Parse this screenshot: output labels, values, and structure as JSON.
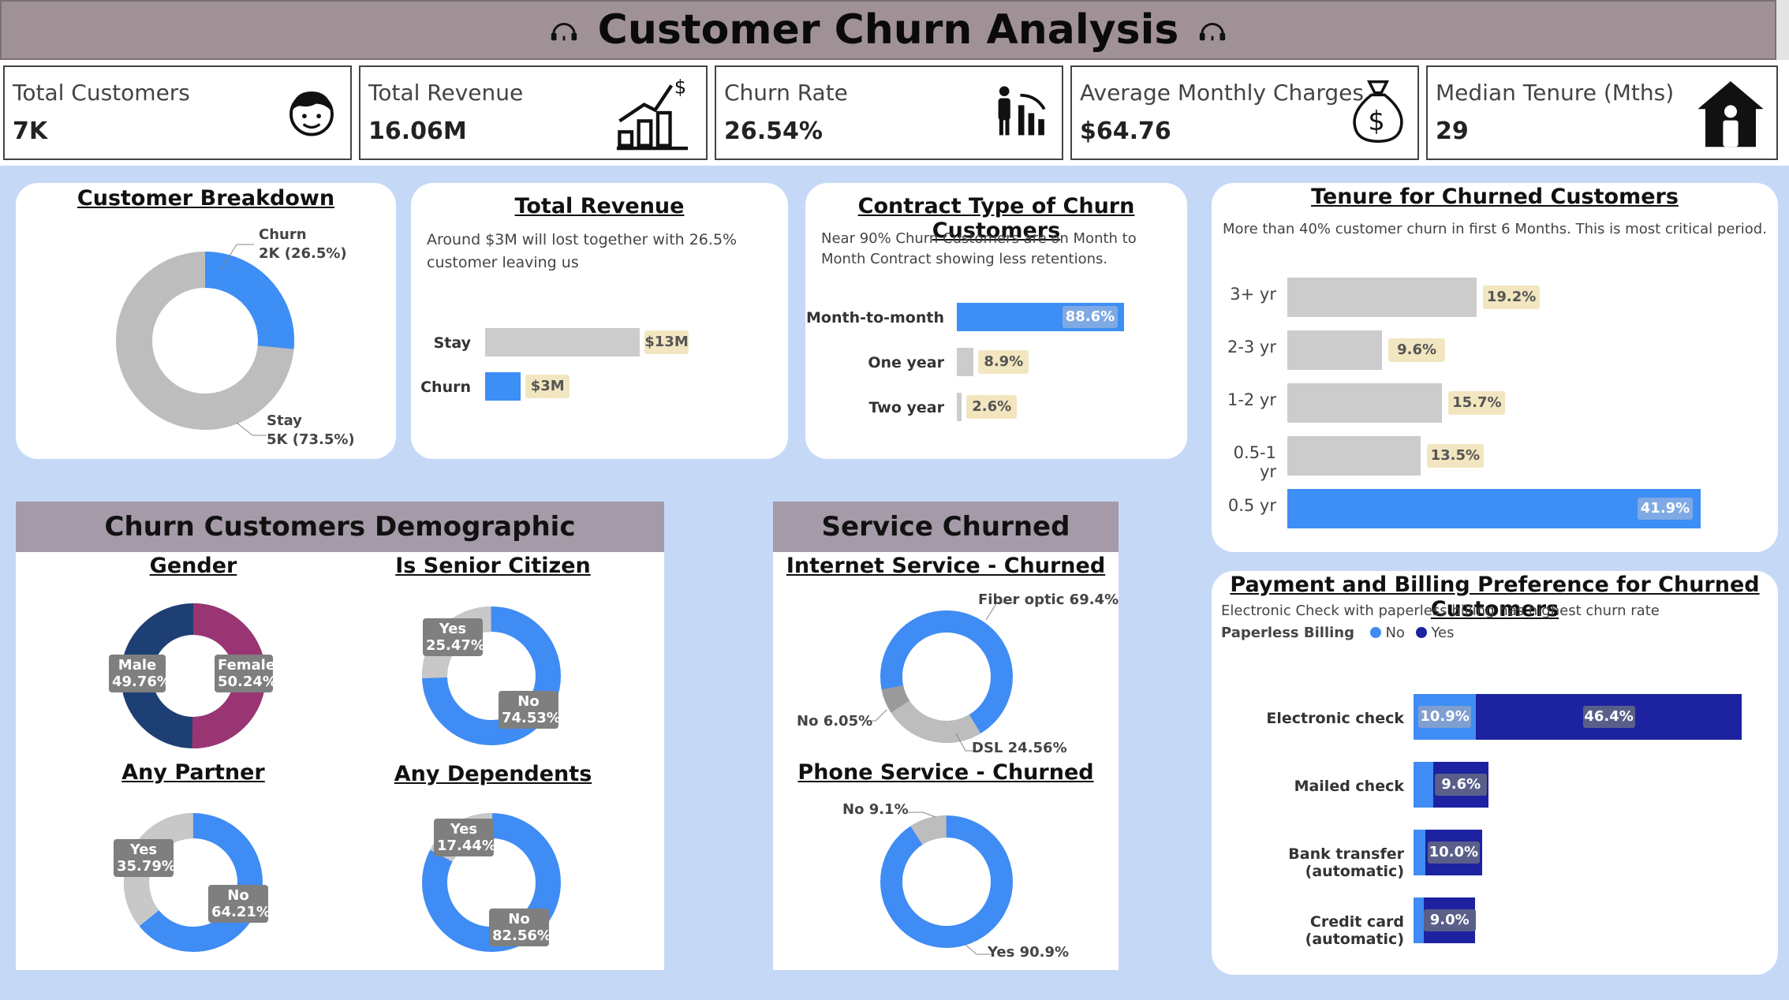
{
  "header": {
    "title": "Customer Churn Analysis",
    "icon": "headset-icon"
  },
  "kpis": [
    {
      "label": "Total Customers",
      "value": "7K",
      "icon": "customer-face-icon"
    },
    {
      "label": "Total Revenue",
      "value": "16.06M",
      "icon": "revenue-growth-icon"
    },
    {
      "label": "Churn Rate",
      "value": "26.54%",
      "icon": "people-decline-icon"
    },
    {
      "label": "Average Monthly Charges",
      "value": "$64.76",
      "icon": "money-bag-icon"
    },
    {
      "label": "Median Tenure (Mths)",
      "value": "29",
      "icon": "house-person-icon"
    }
  ],
  "colors": {
    "blue": "#3d8ef5",
    "grey": "#c8c8c8",
    "navy": "#1d22a0",
    "gender_navy": "#1e3f73",
    "gender_purple": "#9a3573",
    "light_blue": "#3f8cf4",
    "tag": "#f2e6c0"
  },
  "customer_breakdown": {
    "title": "Customer Breakdown",
    "churn_label": "Churn",
    "churn_value": "2K (26.5%)",
    "stay_label": "Stay",
    "stay_value": "5K (73.5%)"
  },
  "total_revenue": {
    "title": "Total Revenue",
    "subtitle": "Around $3M will lost together with 26.5% customer leaving us",
    "rows": [
      {
        "cat": "Stay",
        "label": "$13M"
      },
      {
        "cat": "Churn",
        "label": "$3M"
      }
    ]
  },
  "contract": {
    "title": "Contract Type of Churn Customers",
    "subtitle": "Near 90% Churn Customers are on Month to Month Contract showing less retentions.",
    "rows": [
      {
        "cat": "Month-to-month",
        "label": "88.6%"
      },
      {
        "cat": "One year",
        "label": "8.9%"
      },
      {
        "cat": "Two year",
        "label": "2.6%"
      }
    ]
  },
  "tenure": {
    "title": "Tenure for Churned Customers",
    "subtitle": "More than 40% customer churn in first 6 Months. This is most critical period.",
    "rows": [
      {
        "cat": "3+ yr",
        "label": "19.2%"
      },
      {
        "cat": "2-3 yr",
        "label": "9.6%"
      },
      {
        "cat": "1-2 yr",
        "label": "15.7%"
      },
      {
        "cat": "0.5-1 yr",
        "label": "13.5%"
      },
      {
        "cat": "0.5 yr",
        "label": "41.9%"
      }
    ]
  },
  "demographic": {
    "title": "Churn Customers Demographic",
    "gender": {
      "title": "Gender",
      "male": "Male",
      "male_pct": "49.76%",
      "female": "Female",
      "female_pct": "50.24%"
    },
    "senior": {
      "title": "Is Senior Citizen",
      "yes": "Yes",
      "yes_pct": "25.47%",
      "no": "No",
      "no_pct": "74.53%"
    },
    "partner": {
      "title": "Any Partner",
      "yes": "Yes",
      "yes_pct": "35.79%",
      "no": "No",
      "no_pct": "64.21%"
    },
    "dependents": {
      "title": "Any Dependents",
      "yes": "Yes",
      "yes_pct": "17.44%",
      "no": "No",
      "no_pct": "82.56%"
    }
  },
  "service": {
    "title": "Service Churned",
    "internet": {
      "title": "Internet Service - Churned",
      "fiber": "Fiber optic 69.4%",
      "dsl": "DSL 24.56%",
      "no": "No 6.05%"
    },
    "phone": {
      "title": "Phone Service - Churned",
      "no": "No 9.1%",
      "yes": "Yes 90.9%"
    }
  },
  "payment": {
    "title": "Payment and Billing Preference for Churned Customers",
    "subtitle": "Electronic Check with paperless billing has highest churn rate",
    "legend_title": "Paperless Billing",
    "legend_no": "No",
    "legend_yes": "Yes",
    "rows": [
      {
        "cat": "Electronic check",
        "no_label": "10.9%",
        "yes_label": "46.4%"
      },
      {
        "cat": "Mailed check",
        "no_label": "",
        "yes_label": "9.6%"
      },
      {
        "cat": "Bank transfer (automatic)",
        "no_label": "",
        "yes_label": "10.0%"
      },
      {
        "cat": "Credit card (automatic)",
        "no_label": "",
        "yes_label": "9.0%"
      }
    ]
  },
  "chart_data": [
    {
      "type": "pie",
      "title": "Customer Breakdown",
      "categories": [
        "Churn",
        "Stay"
      ],
      "values": [
        26.5,
        73.5
      ],
      "counts": [
        "2K",
        "5K"
      ]
    },
    {
      "type": "bar",
      "title": "Total Revenue",
      "categories": [
        "Stay",
        "Churn"
      ],
      "values": [
        13,
        3
      ],
      "unit": "$M"
    },
    {
      "type": "bar",
      "title": "Contract Type of Churn Customers",
      "categories": [
        "Month-to-month",
        "One year",
        "Two year"
      ],
      "values": [
        88.6,
        8.9,
        2.6
      ]
    },
    {
      "type": "bar",
      "title": "Tenure for Churned Customers",
      "categories": [
        "3+ yr",
        "2-3 yr",
        "1-2 yr",
        "0.5-1 yr",
        "0.5 yr"
      ],
      "values": [
        19.2,
        9.6,
        15.7,
        13.5,
        41.9
      ]
    },
    {
      "type": "pie",
      "title": "Gender",
      "categories": [
        "Male",
        "Female"
      ],
      "values": [
        49.76,
        50.24
      ]
    },
    {
      "type": "pie",
      "title": "Is Senior Citizen",
      "categories": [
        "Yes",
        "No"
      ],
      "values": [
        25.47,
        74.53
      ]
    },
    {
      "type": "pie",
      "title": "Any Partner",
      "categories": [
        "Yes",
        "No"
      ],
      "values": [
        35.79,
        64.21
      ]
    },
    {
      "type": "pie",
      "title": "Any Dependents",
      "categories": [
        "Yes",
        "No"
      ],
      "values": [
        17.44,
        82.56
      ]
    },
    {
      "type": "pie",
      "title": "Internet Service - Churned",
      "categories": [
        "Fiber optic",
        "DSL",
        "No"
      ],
      "values": [
        69.4,
        24.56,
        6.05
      ]
    },
    {
      "type": "pie",
      "title": "Phone Service - Churned",
      "categories": [
        "No",
        "Yes"
      ],
      "values": [
        9.1,
        90.9
      ]
    },
    {
      "type": "bar",
      "title": "Payment and Billing Preference for Churned Customers",
      "categories": [
        "Electronic check",
        "Mailed check",
        "Bank transfer (automatic)",
        "Credit card (automatic)"
      ],
      "series": [
        {
          "name": "No",
          "values": [
            10.9,
            3.5,
            2.0,
            1.8
          ]
        },
        {
          "name": "Yes",
          "values": [
            46.4,
            9.6,
            10.0,
            9.0
          ]
        }
      ]
    }
  ]
}
